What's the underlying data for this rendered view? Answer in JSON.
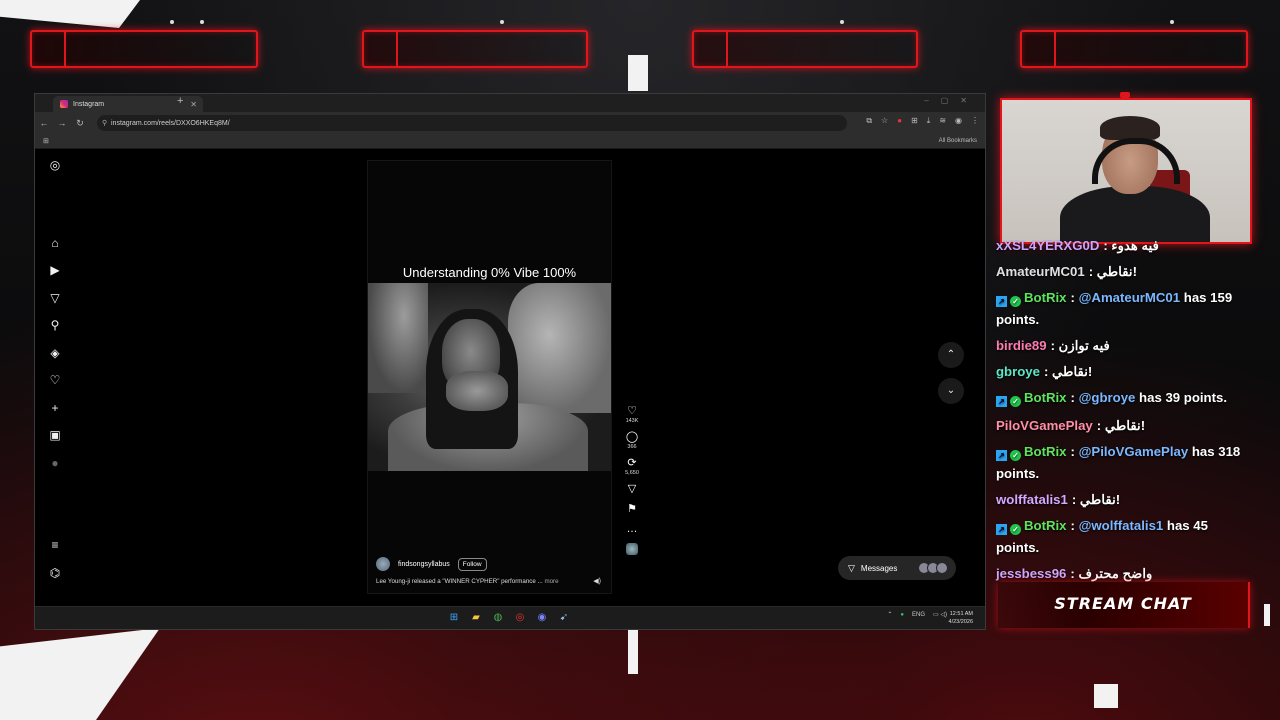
{
  "browser": {
    "tab_title": "Instagram",
    "new_tab": "+",
    "url": "instagram.com/reels/DXXO6HKEq8M/",
    "all_bookmarks": "All Bookmarks"
  },
  "reel": {
    "overlay_text": "Understanding 0% Vibe 100%",
    "username": "findsongsyllabus",
    "follow_label": "Follow",
    "description": "Lee Young-ji released a \"WINNER CYPHER\" performance ...",
    "more_label": "more",
    "likes": "143K",
    "comments": "366",
    "reposts": "5,650"
  },
  "messages_label": "Messages",
  "taskbar": {
    "lang": "ENG",
    "time": "12:51 AM",
    "date": "4/23/2026"
  },
  "chat": {
    "messages": [
      {
        "user": "xXSL4YERXG0D",
        "color": "#c9a6ff",
        "text": "فيه هدوء",
        "bot": false
      },
      {
        "user": "AmateurMC01",
        "color": "#e0e0e0",
        "text": "نقاطي!",
        "bot": false
      },
      {
        "user": "BotRix",
        "color": "#5ee35e",
        "text": "@AmateurMC01 has 159 points.",
        "mention": "@AmateurMC01",
        "bot": true
      },
      {
        "user": "birdie89",
        "color": "#ff7bb0",
        "text": "فيه توازن",
        "bot": false
      },
      {
        "user": "gbroye",
        "color": "#5fe6c8",
        "text": "نقاطي!",
        "bot": false
      },
      {
        "user": "BotRix",
        "color": "#5ee35e",
        "text": "@gbroye has 39 points.",
        "mention": "@gbroye",
        "bot": true
      },
      {
        "user": "PiloVGamePlay",
        "color": "#ff8fa6",
        "text": "نقاطي!",
        "bot": false
      },
      {
        "user": "BotRix",
        "color": "#5ee35e",
        "text": "@PiloVGamePlay has 318 points.",
        "mention": "@PiloVGamePlay",
        "bot": true
      },
      {
        "user": "wolffatalis1",
        "color": "#d6a8ff",
        "text": "نقاطي!",
        "bot": false
      },
      {
        "user": "BotRix",
        "color": "#5ee35e",
        "text": "@wolffatalis1 has 45 points.",
        "mention": "@wolffatalis1",
        "bot": true
      },
      {
        "user": "jessbess96",
        "color": "#d0a8ff",
        "text": "واضح محترف",
        "bot": false
      }
    ],
    "banner": "STREAM CHAT"
  },
  "colors": {
    "accent_red": "#e0161c",
    "mention_blue": "#7ab8ff"
  }
}
